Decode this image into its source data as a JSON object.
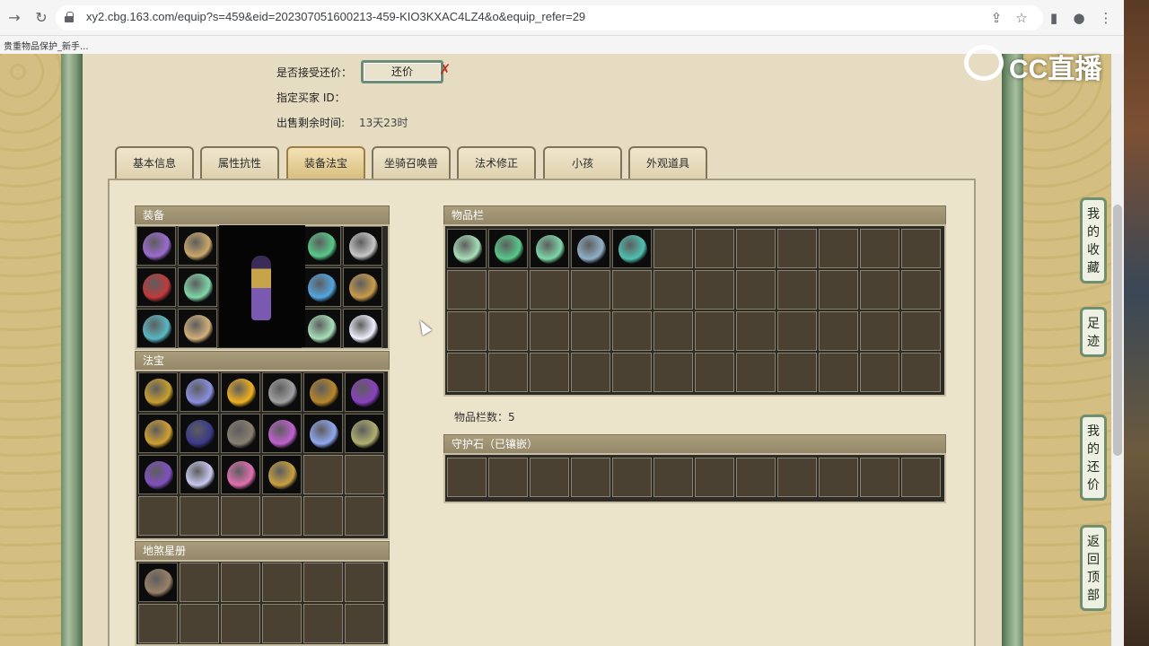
{
  "browser": {
    "url": "xy2.cbg.163.com/equip?s=459&eid=202307051600213-459-KIO3KXAC4LZ4&o&equip_refer=29",
    "bookmark": "贵重物品保护_新手..."
  },
  "watermark": "CC直播",
  "trade": {
    "accept_counter_label": "是否接受还价：",
    "counter_button": "还价",
    "counter_x": "✗",
    "buyer_label": "指定买家 ID：",
    "remaining_label": "出售剩余时间:",
    "remaining_value": "13天23时"
  },
  "tabs": [
    "基本信息",
    "属性抗性",
    "装备法宝",
    "坐骑召唤兽",
    "法术修正",
    "小孩",
    "外观道具"
  ],
  "active_tab_index": 2,
  "sections": {
    "equipment": "装备",
    "fabao": "法宝",
    "disha": "地煞星册",
    "inventory": "物品栏",
    "inventory_count_label": "物品栏数：",
    "inventory_count": "5",
    "guard_stone": "守护石（已镶嵌）"
  },
  "side_buttons": [
    "我的收藏",
    "足迹",
    "我的还价",
    "返回顶部"
  ],
  "icons": {
    "back": "arrow-right-icon",
    "reload": "reload-icon",
    "share": "share-icon",
    "star": "star-icon",
    "sidepanel": "sidepanel-icon",
    "profile": "profile-icon",
    "menu": "menu-icon"
  },
  "item_colors": {
    "equipment": [
      "#9b6bd0",
      "#c9a86a",
      "#58c98a",
      "#c7c7c7",
      "#c0393b",
      "#7fd6a8",
      "#53a5e0",
      "#c99b4a",
      "#5ab8c4",
      "#d2b07a",
      "#a8e0b8",
      "#f0f0ff"
    ],
    "fabao": [
      "#c8a030",
      "#8a8fe0",
      "#f0b020",
      "#a0a0a0",
      "#b8862a",
      "#8a40c0",
      "#d0a030",
      "#3a3a8a",
      "#888070",
      "#c060d0",
      "#90a8f0",
      "#b0b070",
      "#8050c0",
      "#c8c8f0",
      "#e070b0",
      "#c8a040"
    ],
    "disha": [
      "#9a8068"
    ],
    "inventory": [
      "#a8e0b8",
      "#58c98a",
      "#7fd6a8",
      "#8fb0c8",
      "#4fc0b0"
    ]
  }
}
